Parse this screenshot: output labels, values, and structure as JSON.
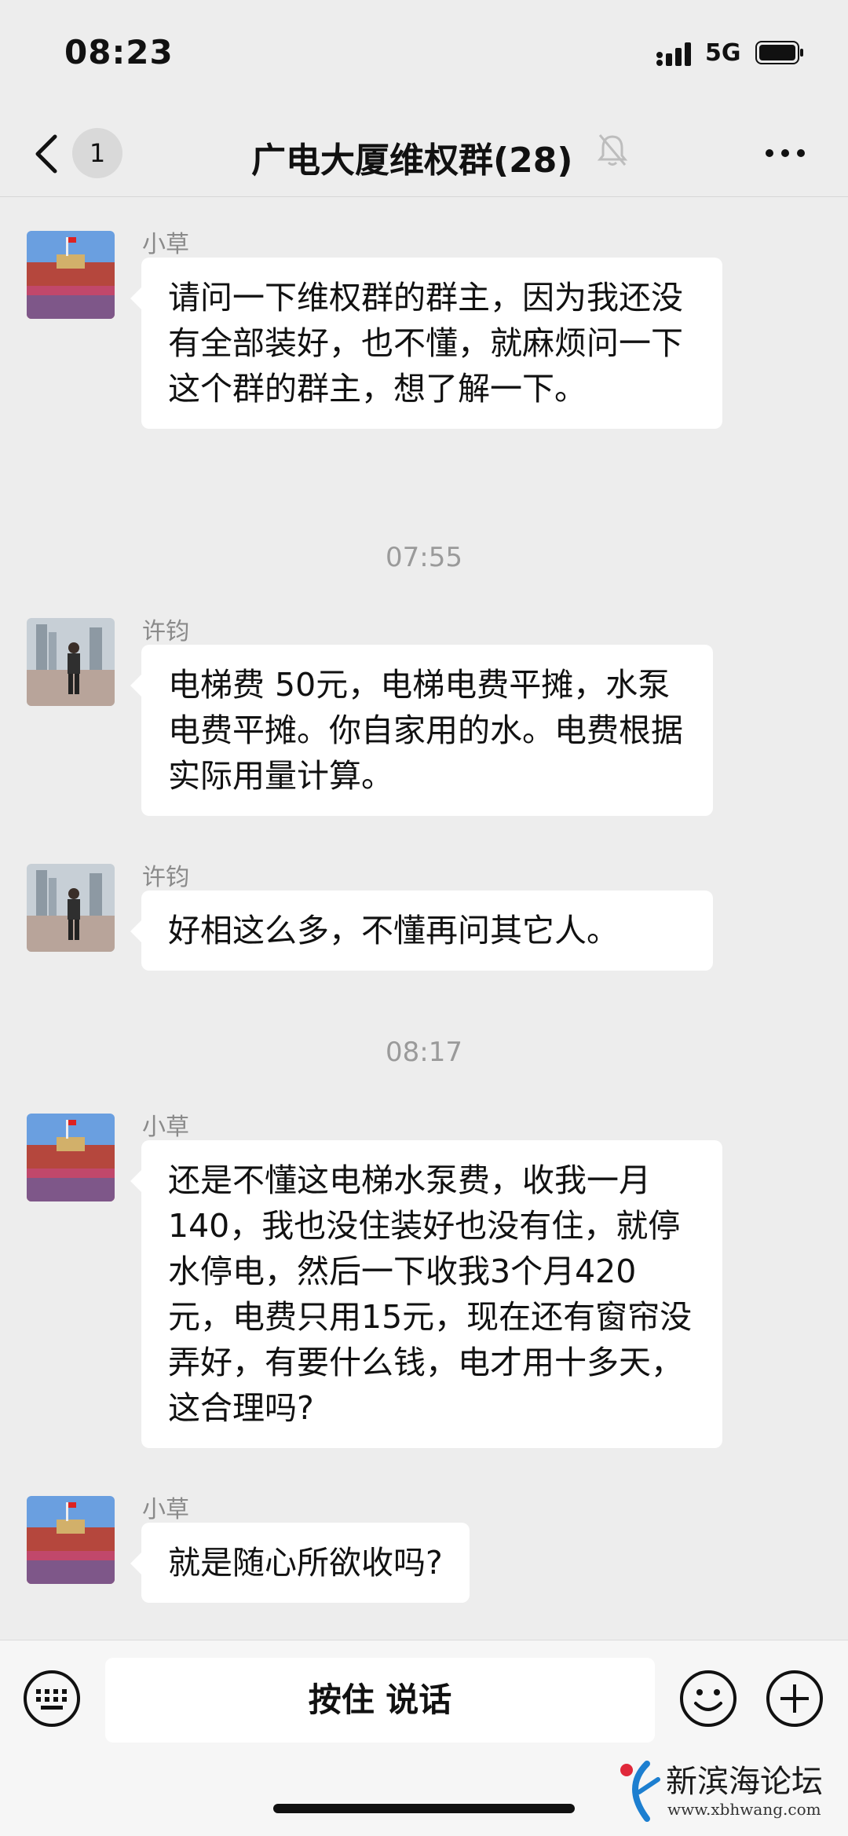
{
  "status_bar": {
    "time": "08:23",
    "network": "5G"
  },
  "nav": {
    "unread_count": "1",
    "title": "广电大厦维权群(28)"
  },
  "messages": [
    {
      "sender": "小草",
      "text": "请问一下维权群的群主，因为我还没有全部装好，也不懂，就麻烦问一下这个群的群主，想了解一下。"
    },
    {
      "time": "07:55"
    },
    {
      "sender": "许钧",
      "text": "电梯费 50元，电梯电费平摊，水泵电费平摊。你自家用的水。电费根据实际用量计算。"
    },
    {
      "sender": "许钧",
      "text": "好相这么多，不懂再问其它人。"
    },
    {
      "time": "08:17"
    },
    {
      "sender": "小草",
      "text": "还是不懂这电梯水泵费，收我一月140，我也没住装好也没有住，就停水停电，然后一下收我3个月420元，电费只用15元，现在还有窗帘没弄好，有要什么钱，电才用十多天，这合理吗?"
    },
    {
      "sender": "小草",
      "text": "就是随心所欲收吗?"
    }
  ],
  "input_bar": {
    "hold_to_talk": "按住 说话"
  },
  "watermark": {
    "title": "新滨海论坛",
    "url": "www.xbhwang.com"
  },
  "icons": [
    "back-icon",
    "mute-icon",
    "more-icon",
    "keyboard-icon",
    "emoji-icon",
    "plus-icon",
    "signal-icon",
    "battery-icon"
  ],
  "colors": {
    "background": "#ededed",
    "bubble": "#ffffff",
    "meta_text": "#8a8a8a",
    "input_bar": "#f6f6f6"
  }
}
